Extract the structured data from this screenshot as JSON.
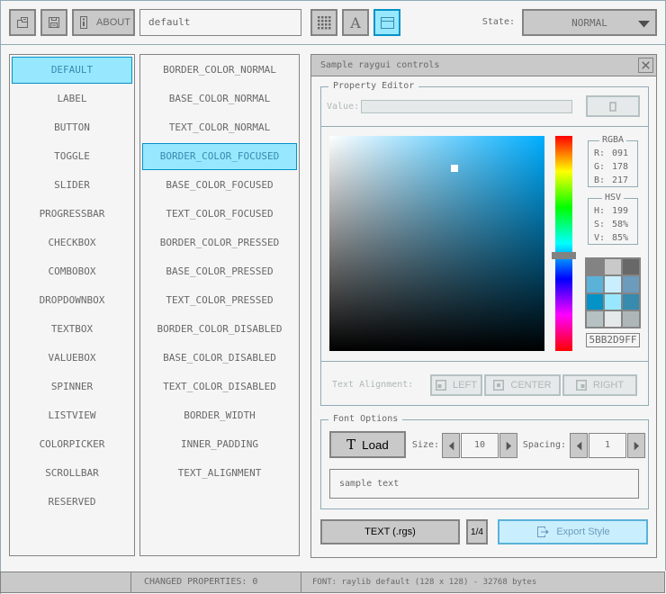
{
  "toolbar": {
    "open_icon": "folder-open-icon",
    "save_icon": "floppy-save-icon",
    "about_button": {
      "icon": "info-icon",
      "label": "ABOUT"
    },
    "style_name_input": {
      "value": "default"
    },
    "table_icon": "dots-grid-icon",
    "font_icon": "letter-a-icon",
    "panel_icon": "window-panel-icon",
    "state_label": "State:",
    "state_dropdown": {
      "value": "NORMAL",
      "icon": "chevron-down-icon"
    }
  },
  "controls_list": {
    "items": [
      "DEFAULT",
      "LABEL",
      "BUTTON",
      "TOGGLE",
      "SLIDER",
      "PROGRESSBAR",
      "CHECKBOX",
      "COMBOBOX",
      "DROPDOWNBOX",
      "TEXTBOX",
      "VALUEBOX",
      "SPINNER",
      "LISTVIEW",
      "COLORPICKER",
      "SCROLLBAR",
      "RESERVED"
    ],
    "selected": "DEFAULT"
  },
  "properties_list": {
    "items": [
      "BORDER_COLOR_NORMAL",
      "BASE_COLOR_NORMAL",
      "TEXT_COLOR_NORMAL",
      "BORDER_COLOR_FOCUSED",
      "BASE_COLOR_FOCUSED",
      "TEXT_COLOR_FOCUSED",
      "BORDER_COLOR_PRESSED",
      "BASE_COLOR_PRESSED",
      "TEXT_COLOR_PRESSED",
      "BORDER_COLOR_DISABLED",
      "BASE_COLOR_DISABLED",
      "TEXT_COLOR_DISABLED",
      "BORDER_WIDTH",
      "INNER_PADDING",
      "TEXT_ALIGNMENT"
    ],
    "selected": "BORDER_COLOR_FOCUSED"
  },
  "sample_window": {
    "title": "Sample raygui controls",
    "close_icon": "close-icon",
    "property_editor": {
      "label": "Property Editor",
      "value_label": "Value:",
      "value_input": "",
      "value_button_icon": "zero-box-icon",
      "color_picker": {
        "selected_hex": "5BB2D9FF",
        "hue": 199,
        "rgba": {
          "title": "RGBA",
          "rows": [
            {
              "label": "R:",
              "value": "091"
            },
            {
              "label": "G:",
              "value": "178"
            },
            {
              "label": "B:",
              "value": "217"
            }
          ]
        },
        "hsv": {
          "title": "HSV",
          "rows": [
            {
              "label": "H:",
              "value": "199"
            },
            {
              "label": "S:",
              "value": "58%"
            },
            {
              "label": "V:",
              "value": "85%"
            }
          ]
        },
        "palette": [
          "#838383",
          "#c9c9c9",
          "#686868",
          "#5bb2d9",
          "#c9effe",
          "#6c9bbc",
          "#0492c7",
          "#97e8ff",
          "#368baf",
          "#b5c1c2",
          "#e6e9e9",
          "#aeb7b8"
        ]
      },
      "text_alignment": {
        "label": "Text Alignment:",
        "buttons": [
          {
            "label": "LEFT",
            "icon": "align-left-icon"
          },
          {
            "label": "CENTER",
            "icon": "align-center-icon"
          },
          {
            "label": "RIGHT",
            "icon": "align-right-icon"
          }
        ]
      }
    },
    "font_options": {
      "label": "Font Options",
      "load_button": {
        "icon": "letter-t-icon",
        "label": "Load"
      },
      "size": {
        "label": "Size:",
        "value": "10"
      },
      "spacing": {
        "label": "Spacing:",
        "value": "1"
      },
      "sample_text": "sample text"
    },
    "export_bar": {
      "format_button": "TEXT (.rgs)",
      "pager_button": "1/4",
      "export_button": {
        "icon": "export-file-icon",
        "label": "Export Style"
      }
    }
  },
  "status_bar": {
    "changed_properties": "CHANGED PROPERTIES: 0",
    "font_info": "FONT: raylib default (128 x 128) - 32768 bytes"
  },
  "colors": {
    "background": "#f5f5f5",
    "border_normal": "#838383",
    "base_normal": "#c9c9c9",
    "text_normal": "#686868",
    "border_focused": "#5bb2d9",
    "base_focused": "#c9effe",
    "text_focused": "#6c9bbc",
    "border_pressed": "#0492c7",
    "base_pressed": "#97e8ff",
    "text_pressed": "#368baf",
    "border_disabled": "#b5c1c2",
    "base_disabled": "#e6e9e9",
    "text_disabled": "#aeb7b8",
    "line": "#90abb5"
  }
}
